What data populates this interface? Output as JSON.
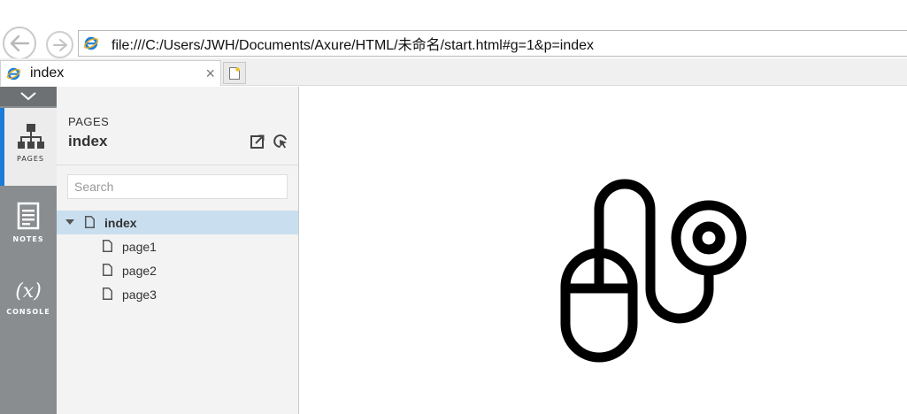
{
  "browser": {
    "address": "file:///C:/Users/JWH/Documents/Axure/HTML/未命名/start.html#g=1&p=index",
    "tab_title": "index",
    "tab_close": "×"
  },
  "rail": {
    "items": [
      {
        "label": "PAGES",
        "icon": "sitemap-icon",
        "active": true
      },
      {
        "label": "NOTES",
        "icon": "notes-icon",
        "active": false
      },
      {
        "label": "CONSOLE",
        "icon": "variables-icon",
        "glyph": "(x)",
        "active": false
      }
    ]
  },
  "sitemap": {
    "kicker": "PAGES",
    "title": "index",
    "search_placeholder": "Search",
    "tree": [
      {
        "label": "index",
        "expanded": true,
        "selected": true,
        "level": 0
      },
      {
        "label": "page1",
        "selected": false,
        "level": 1
      },
      {
        "label": "page2",
        "selected": false,
        "level": 1
      },
      {
        "label": "page3",
        "selected": false,
        "level": 1
      }
    ]
  },
  "canvas": {
    "graphic": "mouse-with-cable-target-icon"
  },
  "colors": {
    "rail_bg": "#8a8d90",
    "rail_active_accent": "#1b7bd6",
    "tree_selected_bg": "#c9dfef",
    "pane_bg": "#f3f3f3"
  }
}
